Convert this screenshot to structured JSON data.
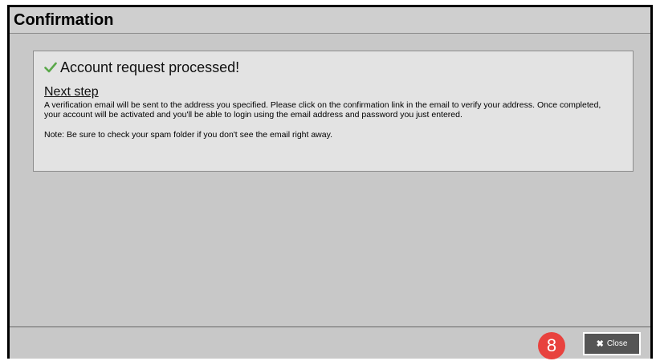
{
  "dialog": {
    "title": "Confirmation"
  },
  "message": {
    "heading": "Account request processed!",
    "subheading": "Next step",
    "paragraph": "A verification email will be sent to the address you specified. Please click on the confirmation link in the email to verify your address. Once completed, your account will be activated and you'll be able to login using the email address and password you just entered.",
    "note": "Note: Be sure to check your spam folder if you don't see the email right away.",
    "check_icon": "check-icon",
    "check_color": "#5aa84a"
  },
  "footer": {
    "step_number": "8",
    "step_badge_color": "#e8423e",
    "close_label": "Close",
    "close_icon": "x-icon"
  }
}
